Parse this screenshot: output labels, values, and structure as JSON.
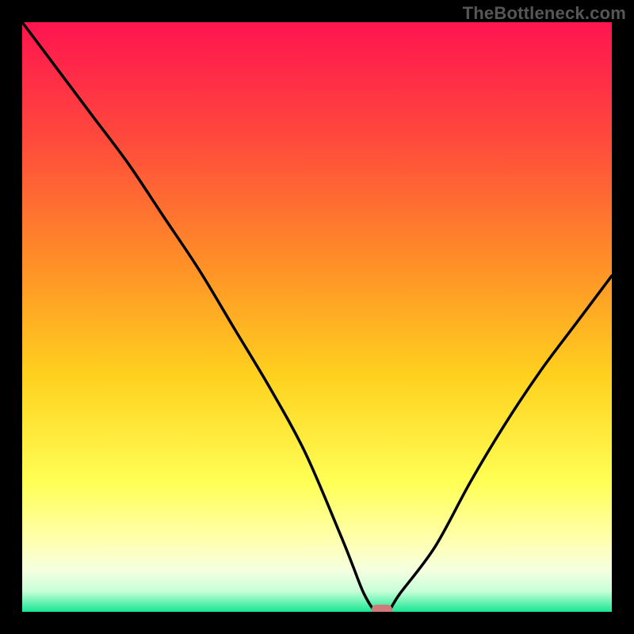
{
  "watermark": "TheBottleneck.com",
  "chart_data": {
    "type": "line",
    "title": "",
    "xlabel": "",
    "ylabel": "",
    "xlim": [
      0,
      100
    ],
    "ylim": [
      0,
      100
    ],
    "x": [
      0,
      6,
      12,
      18,
      24,
      30,
      36,
      42,
      48,
      54,
      56,
      58,
      60,
      62,
      64,
      70,
      76,
      82,
      88,
      94,
      100
    ],
    "values": [
      100,
      92,
      84,
      76,
      67,
      58,
      48,
      38,
      27,
      13,
      8,
      3,
      0,
      0,
      3,
      11,
      22,
      32,
      41,
      49,
      57
    ],
    "marker": {
      "x": 61,
      "y": 0,
      "color": "#d07a7a"
    },
    "background_gradient": {
      "stops": [
        {
          "offset": 0.0,
          "color": "#ff1450"
        },
        {
          "offset": 0.2,
          "color": "#ff4a3c"
        },
        {
          "offset": 0.4,
          "color": "#ff8c28"
        },
        {
          "offset": 0.6,
          "color": "#ffd11e"
        },
        {
          "offset": 0.78,
          "color": "#ffff55"
        },
        {
          "offset": 0.88,
          "color": "#ffffb0"
        },
        {
          "offset": 0.93,
          "color": "#f5ffe0"
        },
        {
          "offset": 0.965,
          "color": "#c8ffd8"
        },
        {
          "offset": 1.0,
          "color": "#17e692"
        }
      ]
    }
  }
}
